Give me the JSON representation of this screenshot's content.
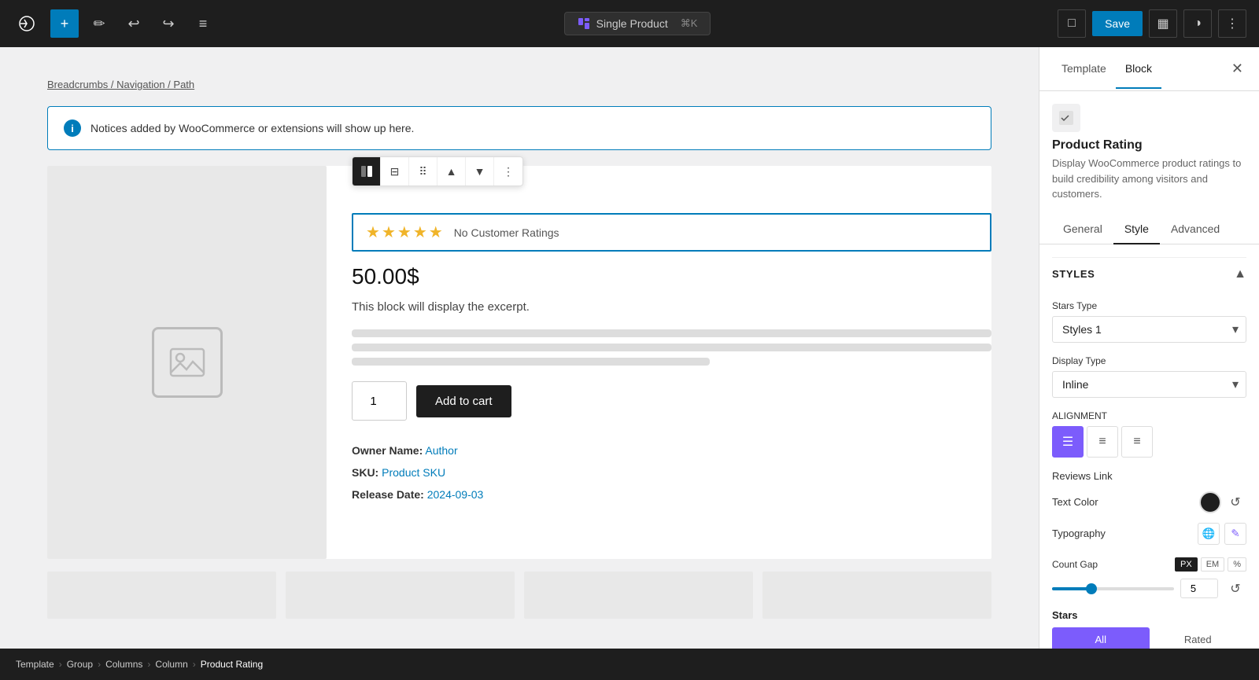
{
  "toolbar": {
    "wp_logo": "W",
    "add_label": "+",
    "draw_label": "✏",
    "undo_label": "↩",
    "redo_label": "↪",
    "list_label": "≡",
    "template_label": "Single Product",
    "shortcut": "⌘K",
    "save_label": "Save",
    "preview_icon": "□",
    "sidebar_icon": "▦",
    "contrast_icon": "◑",
    "more_icon": "⋮"
  },
  "canvas": {
    "breadcrumb": "Breadcrumbs / Navigation / Path",
    "notice_text": "Notices added by WooCommerce or extensions will show up here.",
    "rating_text": "No Customer Ratings",
    "price": "50.00$",
    "excerpt": "This block will display the excerpt.",
    "qty_value": "1",
    "add_to_cart": "Add to cart",
    "owner_label": "Owner Name:",
    "owner_value": "Author",
    "sku_label": "SKU:",
    "sku_value": "Product SKU",
    "release_label": "Release Date:",
    "release_value": "2024-09-03"
  },
  "bottom_bar": {
    "items": [
      "Template",
      "Group",
      "Columns",
      "Column",
      "Product Rating"
    ]
  },
  "sidebar": {
    "tab_template": "Template",
    "tab_block": "Block",
    "block_title": "Product Rating",
    "block_desc": "Display WooCommerce product ratings to build credibility among visitors and customers.",
    "settings_tabs": [
      "General",
      "Style",
      "Advanced"
    ],
    "active_settings_tab": "Style",
    "styles_section_title": "Styles",
    "stars_type_label": "Stars Type",
    "stars_type_value": "Styles 1",
    "display_type_label": "Display Type",
    "display_type_value": "Inline",
    "alignment_label": "ALIGNMENT",
    "alignment_options": [
      "left",
      "center",
      "right"
    ],
    "reviews_link_label": "Reviews Link",
    "text_color_label": "Text Color",
    "typography_label": "Typography",
    "count_gap_label": "Count Gap",
    "count_gap_units": [
      "PX",
      "EM",
      "%"
    ],
    "count_gap_value": "5",
    "stars_label": "Stars",
    "stars_tabs": [
      "All",
      "Rated"
    ]
  }
}
